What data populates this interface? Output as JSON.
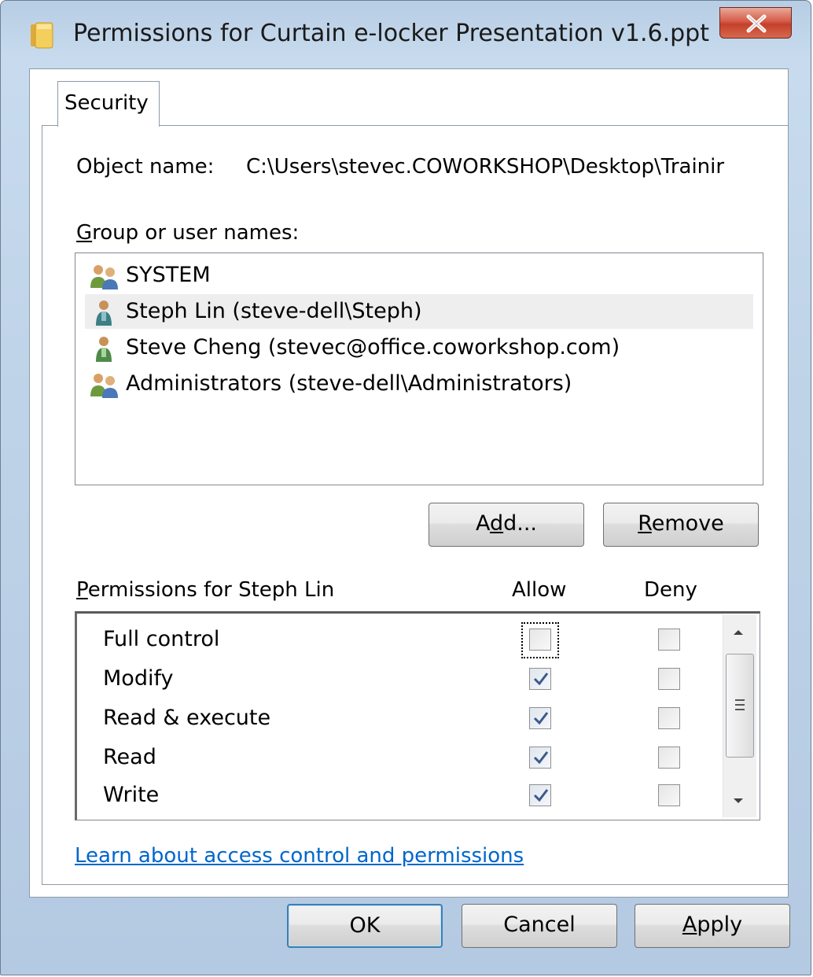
{
  "window": {
    "title": "Permissions for Curtain e-locker Presentation v1.6.ppt",
    "close_icon": "close-icon"
  },
  "tabs": [
    {
      "label": "Security"
    }
  ],
  "object": {
    "label": "Object name:",
    "value": "C:\\Users\\stevec.COWORKSHOP\\Desktop\\Trainir"
  },
  "group": {
    "label_pre": "",
    "label_u": "G",
    "label_post": "roup or user names:",
    "users": [
      {
        "name": "SYSTEM",
        "icon": "group-users-icon"
      },
      {
        "name": "Steph Lin (steve-dell\\Steph)",
        "icon": "user-icon",
        "selected": true
      },
      {
        "name": "Steve Cheng (stevec@office.coworkshop.com)",
        "icon": "user-icon"
      },
      {
        "name": "Administrators (steve-dell\\Administrators)",
        "icon": "group-users-icon"
      }
    ]
  },
  "buttons": {
    "add_pre": "A",
    "add_u": "d",
    "add_post": "d...",
    "remove_u": "R",
    "remove_post": "emove",
    "ok": "OK",
    "cancel": "Cancel",
    "apply_u": "A",
    "apply_post": "pply"
  },
  "permissions": {
    "label_u": "P",
    "label_post": "ermissions for Steph Lin",
    "allow_header": "Allow",
    "deny_header": "Deny",
    "rows": [
      {
        "name": "Full control",
        "allow": false,
        "deny": false
      },
      {
        "name": "Modify",
        "allow": true,
        "deny": false
      },
      {
        "name": "Read & execute",
        "allow": true,
        "deny": false
      },
      {
        "name": "Read",
        "allow": true,
        "deny": false
      },
      {
        "name": "Write",
        "allow": true,
        "deny": false
      }
    ]
  },
  "link": "Learn about access control and permissions"
}
